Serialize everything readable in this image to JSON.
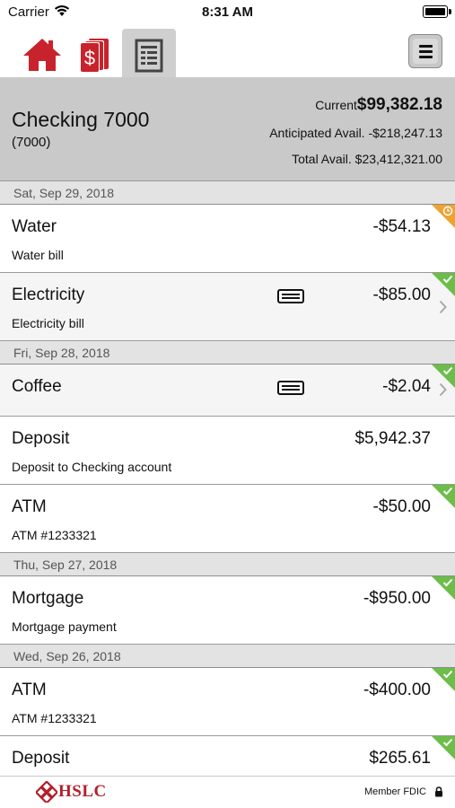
{
  "status_bar": {
    "carrier": "Carrier",
    "time": "8:31 AM"
  },
  "tabs": [
    {
      "icon": "home-icon",
      "active": false
    },
    {
      "icon": "transfer-money-icon",
      "active": false
    },
    {
      "icon": "statement-icon",
      "active": true
    }
  ],
  "account": {
    "name": "Checking 7000",
    "number": "(7000)",
    "current_label": "Current",
    "current_value": "$99,382.18",
    "anticipated_label": "Anticipated Avail.",
    "anticipated_value": "-$218,247.13",
    "total_label": "Total Avail.",
    "total_value": "$23,412,321.00"
  },
  "groups": [
    {
      "date": "Sat, Sep 29, 2018",
      "transactions": [
        {
          "name": "Water",
          "description": "Water bill",
          "amount": "-$54.13",
          "status": "pending"
        },
        {
          "name": "Electricity",
          "description": "Electricity bill",
          "amount": "-$85.00",
          "status": "cleared",
          "card": true,
          "chevron": true
        }
      ]
    },
    {
      "date": "Fri, Sep 28, 2018",
      "transactions": [
        {
          "name": "Coffee",
          "description": "",
          "amount": "-$2.04",
          "status": "cleared",
          "card": true,
          "chevron": true
        },
        {
          "name": "Deposit",
          "description": "Deposit to Checking account",
          "amount": "$5,942.37",
          "status": "none"
        },
        {
          "name": "ATM",
          "description": "ATM #1233321",
          "amount": "-$50.00",
          "status": "cleared"
        }
      ]
    },
    {
      "date": "Thu, Sep 27, 2018",
      "transactions": [
        {
          "name": "Mortgage",
          "description": "Mortgage payment",
          "amount": "-$950.00",
          "status": "cleared"
        }
      ]
    },
    {
      "date": "Wed, Sep 26, 2018",
      "transactions": [
        {
          "name": "ATM",
          "description": "ATM #1233321",
          "amount": "-$400.00",
          "status": "cleared"
        },
        {
          "name": "Deposit",
          "description": "",
          "amount": "$265.61",
          "status": "cleared"
        }
      ]
    }
  ],
  "footer": {
    "brand": "HSLC",
    "fdic": "Member FDIC"
  },
  "colors": {
    "brand_red": "#b31f2a",
    "cleared_green": "#6cbd4a",
    "pending_orange": "#eda333",
    "header_gray": "#c9c9c9"
  }
}
